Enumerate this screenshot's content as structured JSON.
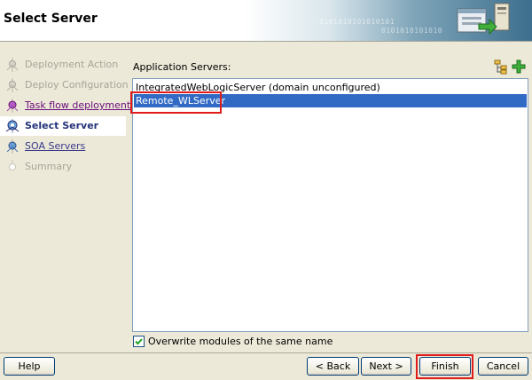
{
  "header": {
    "title": "Select Server",
    "binary_line_1": "0101010101010101",
    "binary_line_2": "0101010101010"
  },
  "steps": [
    {
      "label": "Deployment Action",
      "state": "done"
    },
    {
      "label": "Deploy Configuration",
      "state": "done"
    },
    {
      "label": "Task flow deployment",
      "state": "visited"
    },
    {
      "label": "Select Server",
      "state": "current"
    },
    {
      "label": "SOA Servers",
      "state": "link"
    },
    {
      "label": "Summary",
      "state": "future"
    }
  ],
  "main": {
    "list_label": "Application Servers:",
    "servers": [
      {
        "name": "IntegratedWebLogicServer (domain unconfigured)",
        "selected": false
      },
      {
        "name": "Remote_WLServer",
        "selected": true
      }
    ],
    "overwrite_checkbox": {
      "label": "Overwrite modules of the same name",
      "checked": true
    }
  },
  "buttons": {
    "help": "Help",
    "back": "< Back",
    "next": "Next >",
    "finish": "Finish",
    "cancel": "Cancel"
  },
  "colors": {
    "selection": "#316ac5",
    "highlight": "#e01b1b",
    "current_step": "#24337a",
    "link": "#3b3a8c"
  }
}
